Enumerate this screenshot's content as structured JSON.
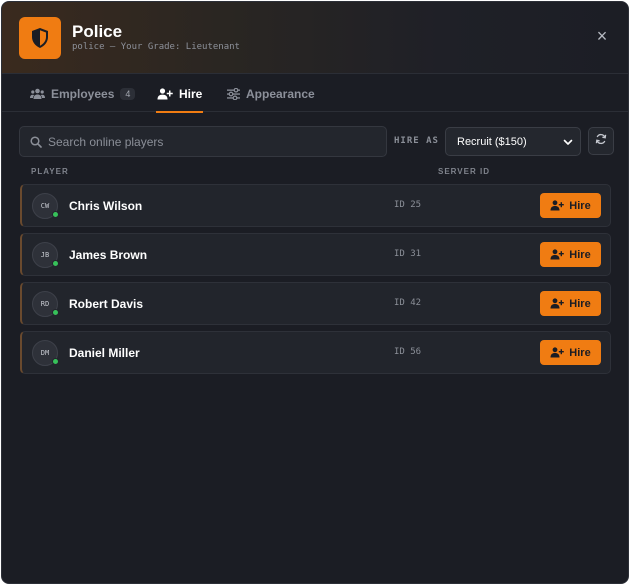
{
  "header": {
    "title": "Police",
    "subtitle": "police — Your Grade: Lieutenant",
    "icon": "shield-icon",
    "close": "×"
  },
  "tabs": [
    {
      "label": "Employees",
      "icon": "users-icon",
      "badge": "4",
      "active": false
    },
    {
      "label": "Hire",
      "icon": "user-plus-icon",
      "active": true
    },
    {
      "label": "Appearance",
      "icon": "sliders-icon",
      "active": false
    }
  ],
  "search": {
    "placeholder": "Search online players",
    "value": ""
  },
  "hire_as": {
    "label": "HIRE AS",
    "selected": "Recruit ($150)"
  },
  "table": {
    "col_player": "PLAYER",
    "col_server_id": "SERVER ID"
  },
  "players": [
    {
      "initials": "CW",
      "name": "Chris Wilson",
      "id": "ID 25",
      "button": "Hire"
    },
    {
      "initials": "JB",
      "name": "James Brown",
      "id": "ID 31",
      "button": "Hire"
    },
    {
      "initials": "RD",
      "name": "Robert Davis",
      "id": "ID 42",
      "button": "Hire"
    },
    {
      "initials": "DM",
      "name": "Daniel Miller",
      "id": "ID 56",
      "button": "Hire"
    }
  ],
  "colors": {
    "accent": "#f07c12",
    "background": "#1b1d24",
    "online": "#37c15a"
  }
}
